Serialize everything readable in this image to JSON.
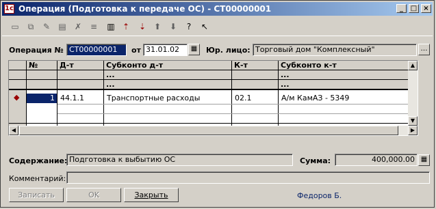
{
  "window": {
    "title": "Операция (Подготовка к передаче ОС) - СТ00000001",
    "controls": {
      "minimize": "_",
      "maximize": "□",
      "close": "×"
    }
  },
  "toolbar": {
    "icons": [
      "new-row-icon",
      "copy-row-icon",
      "edit-row-icon",
      "add-folder-icon",
      "delete-row-icon",
      "list-icon",
      "move-up-icon",
      "move-down-icon",
      "arrow-up-icon",
      "arrow-down-icon",
      "help-icon",
      "whats-this-icon"
    ]
  },
  "header": {
    "op_label": "Операция №",
    "op_number": "СТ00000001",
    "date_label": "от",
    "date_value": "31.01.02",
    "entity_label": "Юр. лицо:",
    "entity_value": "Торговый дом \"Комплексный\""
  },
  "grid": {
    "columns": [
      "№",
      "Д-т",
      "Субконто д-т",
      "К-т",
      "Субконто к-т"
    ],
    "sub_ellipsis": "...",
    "rows": [
      {
        "num": "1",
        "debit": "44.1.1",
        "sub_debit": "Транспортные расходы",
        "credit": "02.1",
        "sub_credit": "А/м КамАЗ - 5349"
      }
    ]
  },
  "footer": {
    "content_label": "Содержание:",
    "content_value": "Подготовка к выбытию ОС",
    "sum_label": "Сумма:",
    "sum_value": "400,000.00",
    "comment_label": "Комментарий:",
    "comment_value": ""
  },
  "buttons": {
    "save": "Записать",
    "ok": "OK",
    "close": "Закрыть"
  },
  "author": "Федоров Б."
}
